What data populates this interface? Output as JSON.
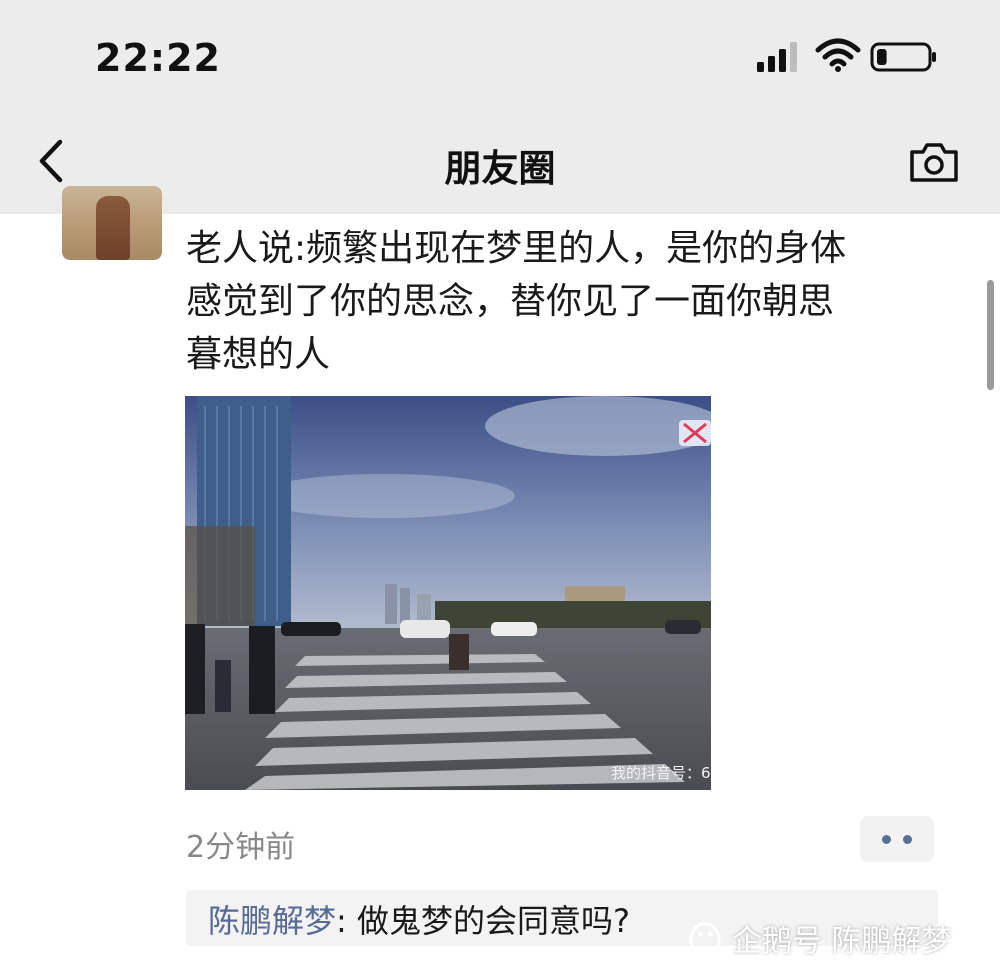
{
  "status_bar": {
    "time": "22:22",
    "signal_icon": "cellular-signal-icon",
    "wifi_icon": "wifi-icon",
    "battery_icon": "battery-icon",
    "battery_level": 0.2
  },
  "nav": {
    "back_icon": "chevron-left-icon",
    "title": "朋友圈",
    "camera_icon": "camera-icon"
  },
  "post": {
    "text": "老人说:频繁出现在梦里的人，是你的身体\n感觉到了你的思念，替你见了一面你朝思\n暮想的人",
    "media_caption": "我的抖音号：6",
    "timestamp": "2分钟前"
  },
  "comment": {
    "author": "陈鹏解梦",
    "separator": ": ",
    "text": "做鬼梦的会同意吗?"
  },
  "source_watermark": {
    "text": "企鹅号 陈鹏解梦"
  },
  "colors": {
    "header_bg": "#ececec",
    "link_blue": "#576b95",
    "muted_gray": "#888888"
  }
}
